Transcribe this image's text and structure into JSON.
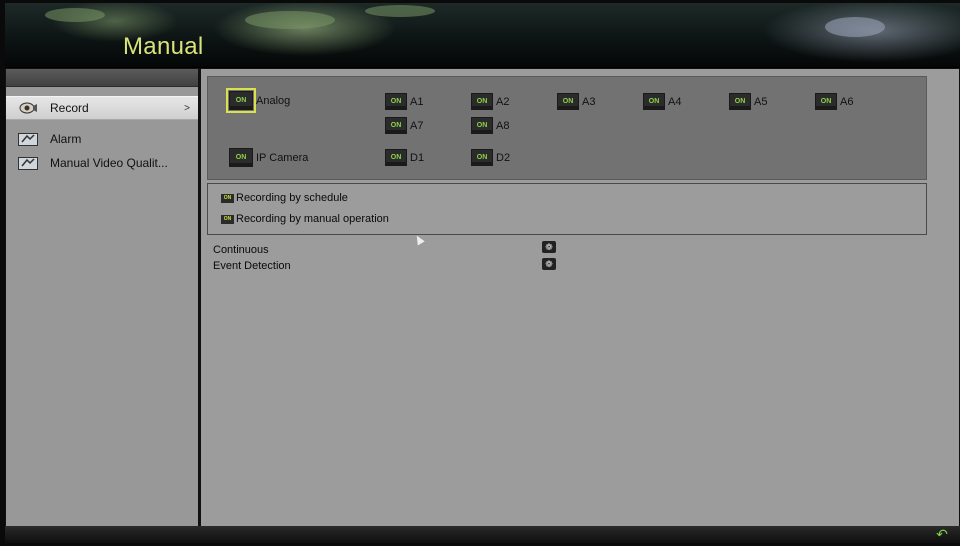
{
  "header": {
    "title": "Manual"
  },
  "sidebar": {
    "items": [
      {
        "label": "Record",
        "icon": "record-icon",
        "active": true,
        "arrow": ">"
      },
      {
        "label": "Alarm",
        "icon": "alarm-icon",
        "active": false
      },
      {
        "label": "Manual Video Qualit...",
        "icon": "video-quality-icon",
        "active": false
      }
    ]
  },
  "cameras": {
    "on_text": "ON",
    "analog_label": "Analog",
    "ip_label": "IP Camera",
    "analog": [
      "A1",
      "A2",
      "A3",
      "A4",
      "A5",
      "A6",
      "A7",
      "A8"
    ],
    "ip": [
      "D1",
      "D2"
    ]
  },
  "modes": {
    "on_text": "ON",
    "schedule_label": "Recording by schedule",
    "manual_label": "Recording by manual operation"
  },
  "record_types": [
    {
      "label": "Continuous"
    },
    {
      "label": "Event Detection"
    }
  ],
  "colors": {
    "accent": "#d8e37a",
    "on_green": "#8ed24b",
    "panel_gray": "#9c9c9c"
  }
}
